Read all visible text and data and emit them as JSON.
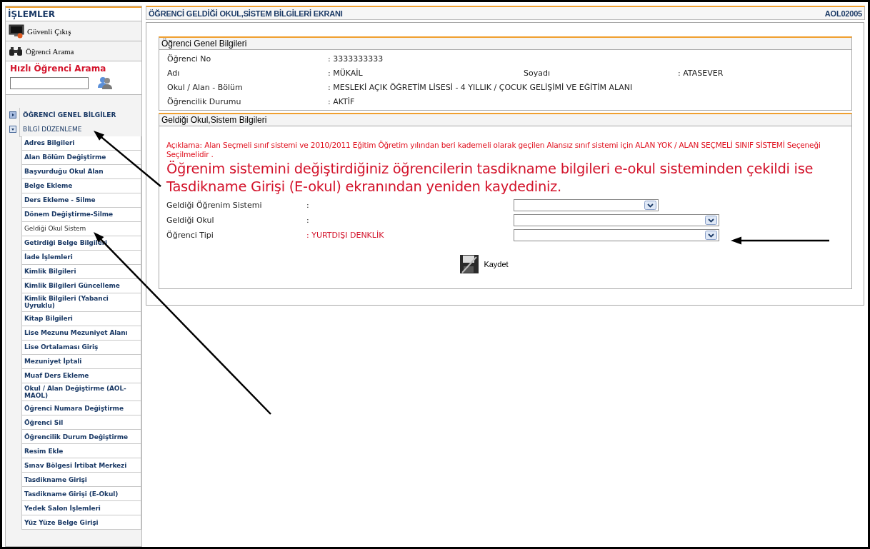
{
  "sidebar": {
    "title": "İŞLEMLER",
    "buttons": [
      {
        "label": "Güvenli Çıkış",
        "kind": "exit"
      },
      {
        "label": "Öğrenci Arama",
        "kind": "search"
      }
    ],
    "quick_search": {
      "title": "Hızlı Öğrenci Arama"
    },
    "sections": [
      {
        "label": "ÖĞRENCİ GENEL BİLGİLER",
        "expanded": false
      },
      {
        "label": "BİLGİ DÜZENLEME",
        "expanded": true,
        "children": [
          {
            "label": "Adres Bilgileri",
            "selected": false
          },
          {
            "label": "Alan Bölüm Değiştirme",
            "selected": false
          },
          {
            "label": "Başvurduğu Okul Alan",
            "selected": false
          },
          {
            "label": "Belge Ekleme",
            "selected": false
          },
          {
            "label": "Ders Ekleme - Silme",
            "selected": false
          },
          {
            "label": "Dönem Değiştirme-Silme",
            "selected": false
          },
          {
            "label": "Geldiği Okul Sistem",
            "selected": true
          },
          {
            "label": "Getirdiği Belge Bilgileri",
            "selected": false
          },
          {
            "label": "İade İşlemleri",
            "selected": false
          },
          {
            "label": "Kimlik Bilgileri",
            "selected": false
          },
          {
            "label": "Kimlik Bilgileri Güncelleme",
            "selected": false
          },
          {
            "label": "Kimlik Bilgileri (Yabanci Uyruklu)",
            "selected": false
          },
          {
            "label": "Kitap Bilgileri",
            "selected": false
          },
          {
            "label": "Lise Mezunu Mezuniyet Alanı",
            "selected": false
          },
          {
            "label": "Lise Ortalaması Giriş",
            "selected": false
          },
          {
            "label": "Mezuniyet İptali",
            "selected": false
          },
          {
            "label": "Muaf Ders Ekleme",
            "selected": false
          },
          {
            "label": "Okul / Alan Değiştirme (AOL-MAOL)",
            "selected": false
          },
          {
            "label": "Öğrenci Numara Değiştirme",
            "selected": false
          },
          {
            "label": "Öğrenci Sil",
            "selected": false
          },
          {
            "label": "Öğrencilik Durum Değiştirme",
            "selected": false
          },
          {
            "label": "Resim Ekle",
            "selected": false
          },
          {
            "label": "Sınav Bölgesi İrtibat Merkezi",
            "selected": false
          },
          {
            "label": "Tasdikname Girişi",
            "selected": false
          },
          {
            "label": "Tasdikname Girişi (E-Okul)",
            "selected": false
          },
          {
            "label": "Yedek Salon İşlemleri",
            "selected": false
          },
          {
            "label": "Yüz Yüze Belge Girişi",
            "selected": false
          }
        ]
      }
    ]
  },
  "main": {
    "title": "ÖĞRENCİ GELDİĞİ OKUL,SİSTEM BİLGİLERİ EKRANI",
    "code": "AOL02005",
    "student_panel": {
      "title": "Öğrenci Genel Bilgileri",
      "rows": [
        [
          {
            "label": "Öğrenci No",
            "value": ": 3333333333"
          }
        ],
        [
          {
            "label": "Adı",
            "value": ": MÜKAİL"
          },
          {
            "label": "Soyadı",
            "value": ": ATASEVER"
          }
        ],
        [
          {
            "label": "Okul / Alan - Bölüm",
            "value": ": MESLEKİ AÇIK ÖĞRETİM LİSESİ - 4 YILLIK / ÇOCUK GELİŞİMİ VE EĞİTİM ALANI"
          }
        ],
        [
          {
            "label": "Öğrencilik Durumu",
            "value": ": AKTİF"
          }
        ]
      ]
    },
    "school_panel": {
      "title": "Geldiği Okul,Sistem Bilgileri",
      "note": "Açıklama: Alan Seçmeli sınıf sistemi ve 2010/2011 Eğitim Öğretim yılından beri kademeli olarak geçilen Alansız sınıf sistemi için ALAN YOK / ALAN SEÇMELİ SINIF SİSTEMİ Seçeneği Seçilmelidir .",
      "warning": "Öğrenim sistemini değiştirdiğiniz öğrencilerin tasdikname bilgileri e-okul sisteminden çekildi ise Tasdikname Girişi (E-okul) ekranından yeniden kaydediniz.",
      "fields": [
        {
          "label": "Geldiği Öğrenim Sistemi",
          "value": ":",
          "kind": "short"
        },
        {
          "label": "Geldiği Okul",
          "value": ":",
          "kind": "long"
        },
        {
          "label": "Öğrenci Tipi",
          "value": ": YURTDIŞI DENKLİK",
          "kind": "long"
        }
      ],
      "save_button": "Kaydet"
    }
  }
}
